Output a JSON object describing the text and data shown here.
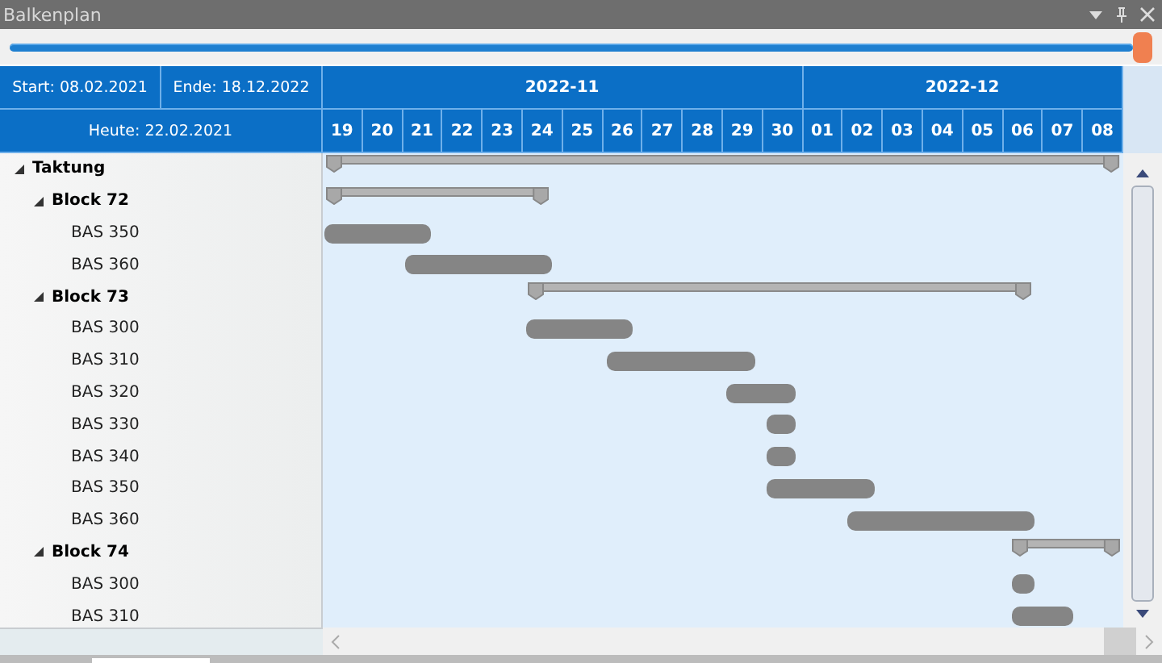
{
  "window": {
    "title": "Balkenplan"
  },
  "zoom_slider": {
    "level": 1
  },
  "header": {
    "start": "Start: 08.02.2021",
    "end": "Ende: 18.12.2022",
    "today": "Heute: 22.02.2021",
    "months": [
      {
        "label": "2022-11",
        "days": [
          "19",
          "20",
          "21",
          "22",
          "23",
          "24",
          "25",
          "26",
          "27",
          "28",
          "29",
          "30"
        ]
      },
      {
        "label": "2022-12",
        "days": [
          "01",
          "02",
          "03",
          "04",
          "05",
          "06",
          "07",
          "08"
        ]
      }
    ]
  },
  "tree": [
    {
      "label": "Taktung",
      "kind": "summary",
      "expanded": true,
      "children": [
        {
          "label": "Block 72",
          "kind": "summary",
          "expanded": true,
          "children": [
            {
              "label": "BAS 350",
              "kind": "task"
            },
            {
              "label": "BAS 360",
              "kind": "task"
            }
          ]
        },
        {
          "label": "Block 73",
          "kind": "summary",
          "expanded": true,
          "children": [
            {
              "label": "BAS 300",
              "kind": "task"
            },
            {
              "label": "BAS 310",
              "kind": "task"
            },
            {
              "label": "BAS 320",
              "kind": "task"
            },
            {
              "label": "BAS 330",
              "kind": "task"
            },
            {
              "label": "BAS 340",
              "kind": "task"
            },
            {
              "label": "BAS 350",
              "kind": "task"
            },
            {
              "label": "BAS 360",
              "kind": "task"
            }
          ]
        },
        {
          "label": "Block 74",
          "kind": "summary",
          "expanded": true,
          "children": [
            {
              "label": "BAS 300",
              "kind": "task"
            },
            {
              "label": "BAS 310",
              "kind": "task"
            }
          ]
        }
      ]
    }
  ]
}
